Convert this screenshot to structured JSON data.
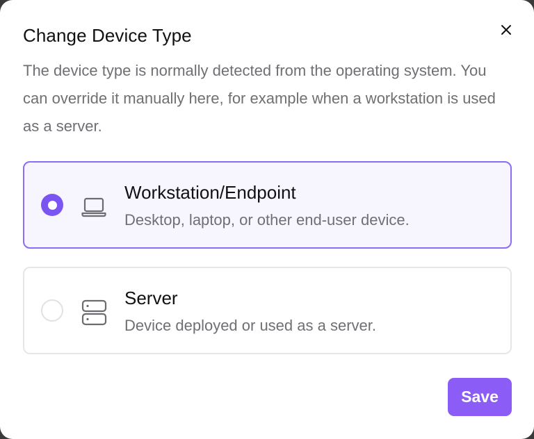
{
  "dialog": {
    "title": "Change Device Type",
    "description": "The device type is normally detected from the operating system. You can override it manually here, for example when a workstation is used as a server.",
    "close_icon": "close-icon",
    "options": [
      {
        "title": "Workstation/Endpoint",
        "subtitle": "Desktop, laptop, or other end-user device.",
        "icon": "laptop-icon",
        "selected": true
      },
      {
        "title": "Server",
        "subtitle": "Device deployed or used as a server.",
        "icon": "server-icon",
        "selected": false
      }
    ],
    "save_label": "Save"
  },
  "colors": {
    "accent": "#8b5cf6",
    "selected_border": "#8b6cf5",
    "selected_background": "#f7f5fe",
    "muted_text": "#6f6f74"
  }
}
